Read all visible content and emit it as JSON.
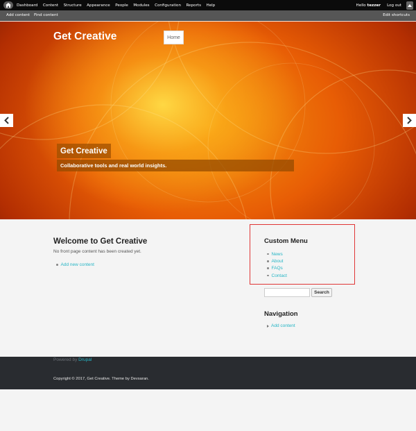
{
  "admin_toolbar": {
    "home_icon": "home-icon",
    "menu": [
      "Dashboard",
      "Content",
      "Structure",
      "Appearance",
      "People",
      "Modules",
      "Configuration",
      "Reports",
      "Help"
    ],
    "hello_prefix": "Hello",
    "username": "tezzer",
    "logout": "Log out",
    "toggle_icon": "chevron-up-icon"
  },
  "shortcuts": {
    "items": [
      "Add content",
      "Find content"
    ],
    "edit_label": "Edit shortcuts"
  },
  "header": {
    "site_name": "Get Creative",
    "nav_home": "Home"
  },
  "slideshow": {
    "title": "Get Creative",
    "caption": "Collaborative tools and real world insights.",
    "prev_icon": "chevron-left-icon",
    "next_icon": "chevron-right-icon"
  },
  "main": {
    "title": "Welcome to Get Creative",
    "message": "No front page content has been created yet.",
    "link": "Add new content"
  },
  "sidebar": {
    "custom_menu": {
      "title": "Custom Menu",
      "items": [
        "News",
        "About",
        "FAQs",
        "Contact"
      ]
    },
    "search": {
      "placeholder": "",
      "button": "Search"
    },
    "navigation": {
      "title": "Navigation",
      "items": [
        "Add content"
      ]
    }
  },
  "footer": {
    "powered_prefix": "Powered by",
    "powered_link": "Drupal",
    "copyright": "Copyright © 2017, Get Creative. Theme by Devsaran."
  },
  "colors": {
    "accent": "#26b5c5",
    "highlight_border": "#e03535",
    "footer_bg": "#292c30"
  }
}
